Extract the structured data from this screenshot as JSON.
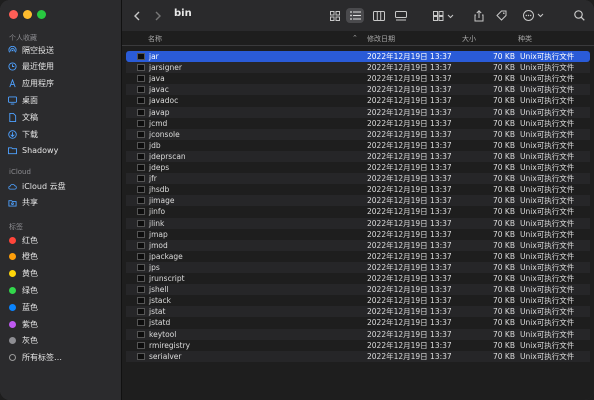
{
  "toolbar": {
    "title": "bin"
  },
  "sidebar": {
    "favorites_title": "个人收藏",
    "favorites": [
      {
        "label": "隔空投送",
        "icon": "airdrop-icon"
      },
      {
        "label": "最近使用",
        "icon": "clock-icon"
      },
      {
        "label": "应用程序",
        "icon": "apps-icon"
      },
      {
        "label": "桌面",
        "icon": "desktop-icon"
      },
      {
        "label": "文稿",
        "icon": "document-icon"
      },
      {
        "label": "下载",
        "icon": "download-icon"
      },
      {
        "label": "Shadowy",
        "icon": "folder-icon"
      }
    ],
    "icloud_title": "iCloud",
    "icloud": [
      {
        "label": "iCloud 云盘",
        "icon": "cloud-icon"
      },
      {
        "label": "共享",
        "icon": "shared-icon"
      }
    ],
    "tags_title": "标签",
    "tags": [
      {
        "label": "红色",
        "color": "#ff453a"
      },
      {
        "label": "橙色",
        "color": "#ff9f0a"
      },
      {
        "label": "黄色",
        "color": "#ffd60a"
      },
      {
        "label": "绿色",
        "color": "#32d74b"
      },
      {
        "label": "蓝色",
        "color": "#0a84ff"
      },
      {
        "label": "紫色",
        "color": "#bf5af2"
      },
      {
        "label": "灰色",
        "color": "#8e8e93"
      },
      {
        "label": "所有标签…",
        "color": ""
      }
    ]
  },
  "columns": {
    "name": "名称",
    "date": "修改日期",
    "size": "大小",
    "kind": "种类"
  },
  "files": [
    {
      "name": "jar",
      "date": "2022年12月19日 13:37",
      "size": "70 KB",
      "kind": "Unix可执行文件"
    },
    {
      "name": "jarsigner",
      "date": "2022年12月19日 13:37",
      "size": "70 KB",
      "kind": "Unix可执行文件"
    },
    {
      "name": "java",
      "date": "2022年12月19日 13:37",
      "size": "70 KB",
      "kind": "Unix可执行文件"
    },
    {
      "name": "javac",
      "date": "2022年12月19日 13:37",
      "size": "70 KB",
      "kind": "Unix可执行文件"
    },
    {
      "name": "javadoc",
      "date": "2022年12月19日 13:37",
      "size": "70 KB",
      "kind": "Unix可执行文件"
    },
    {
      "name": "javap",
      "date": "2022年12月19日 13:37",
      "size": "70 KB",
      "kind": "Unix可执行文件"
    },
    {
      "name": "jcmd",
      "date": "2022年12月19日 13:37",
      "size": "70 KB",
      "kind": "Unix可执行文件"
    },
    {
      "name": "jconsole",
      "date": "2022年12月19日 13:37",
      "size": "70 KB",
      "kind": "Unix可执行文件"
    },
    {
      "name": "jdb",
      "date": "2022年12月19日 13:37",
      "size": "70 KB",
      "kind": "Unix可执行文件"
    },
    {
      "name": "jdeprscan",
      "date": "2022年12月19日 13:37",
      "size": "70 KB",
      "kind": "Unix可执行文件"
    },
    {
      "name": "jdeps",
      "date": "2022年12月19日 13:37",
      "size": "70 KB",
      "kind": "Unix可执行文件"
    },
    {
      "name": "jfr",
      "date": "2022年12月19日 13:37",
      "size": "70 KB",
      "kind": "Unix可执行文件"
    },
    {
      "name": "jhsdb",
      "date": "2022年12月19日 13:37",
      "size": "70 KB",
      "kind": "Unix可执行文件"
    },
    {
      "name": "jimage",
      "date": "2022年12月19日 13:37",
      "size": "70 KB",
      "kind": "Unix可执行文件"
    },
    {
      "name": "jinfo",
      "date": "2022年12月19日 13:37",
      "size": "70 KB",
      "kind": "Unix可执行文件"
    },
    {
      "name": "jlink",
      "date": "2022年12月19日 13:37",
      "size": "70 KB",
      "kind": "Unix可执行文件"
    },
    {
      "name": "jmap",
      "date": "2022年12月19日 13:37",
      "size": "70 KB",
      "kind": "Unix可执行文件"
    },
    {
      "name": "jmod",
      "date": "2022年12月19日 13:37",
      "size": "70 KB",
      "kind": "Unix可执行文件"
    },
    {
      "name": "jpackage",
      "date": "2022年12月19日 13:37",
      "size": "70 KB",
      "kind": "Unix可执行文件"
    },
    {
      "name": "jps",
      "date": "2022年12月19日 13:37",
      "size": "70 KB",
      "kind": "Unix可执行文件"
    },
    {
      "name": "jrunscript",
      "date": "2022年12月19日 13:37",
      "size": "70 KB",
      "kind": "Unix可执行文件"
    },
    {
      "name": "jshell",
      "date": "2022年12月19日 13:37",
      "size": "70 KB",
      "kind": "Unix可执行文件"
    },
    {
      "name": "jstack",
      "date": "2022年12月19日 13:37",
      "size": "70 KB",
      "kind": "Unix可执行文件"
    },
    {
      "name": "jstat",
      "date": "2022年12月19日 13:37",
      "size": "70 KB",
      "kind": "Unix可执行文件"
    },
    {
      "name": "jstatd",
      "date": "2022年12月19日 13:37",
      "size": "70 KB",
      "kind": "Unix可执行文件"
    },
    {
      "name": "keytool",
      "date": "2022年12月19日 13:37",
      "size": "70 KB",
      "kind": "Unix可执行文件"
    },
    {
      "name": "rmiregistry",
      "date": "2022年12月19日 13:37",
      "size": "70 KB",
      "kind": "Unix可执行文件"
    },
    {
      "name": "serialver",
      "date": "2022年12月19日 13:37",
      "size": "70 KB",
      "kind": "Unix可执行文件"
    }
  ],
  "selected_index": 0,
  "colors": {
    "selection": "#2a5bd7",
    "sidebar_accent": "#4ea1ff"
  }
}
